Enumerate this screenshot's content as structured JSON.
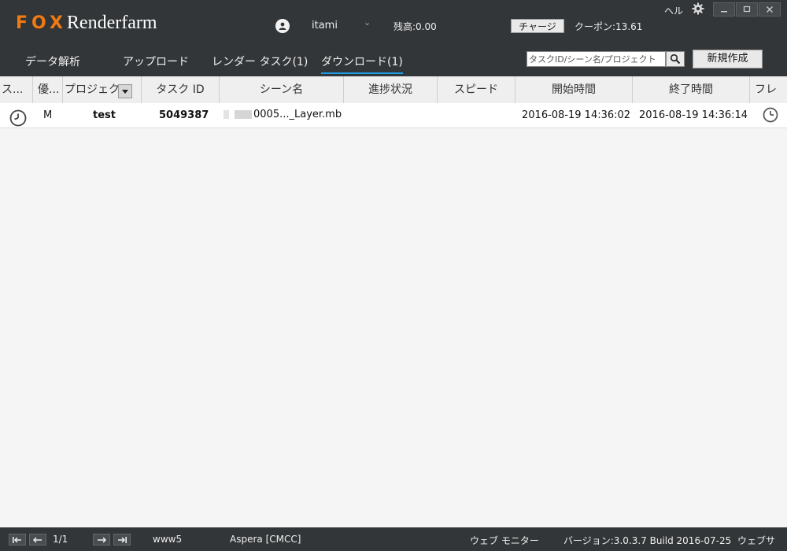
{
  "header": {
    "logo_fox": "FOX",
    "logo_text": "Renderfarm",
    "username": "itami",
    "balance": "残高:0.00",
    "charge_label": "チャージ",
    "coupon": "クーポン:13.61",
    "help_label": "ヘル"
  },
  "nav": {
    "tabs": [
      {
        "label": "データ解析"
      },
      {
        "label": "アップロード"
      },
      {
        "label": "レンダー タスク(1)"
      },
      {
        "label": "ダウンロード(1)"
      }
    ],
    "active_tab": 3,
    "search_placeholder": "タスクID/シーン名/プロジェクト",
    "new_label": "新規作成"
  },
  "table": {
    "columns": [
      "ス...",
      "優...",
      "プロジェク",
      "タスク ID",
      "シーン名",
      "進捗状況",
      "スピード",
      "開始時間",
      "終了時間",
      "フレ"
    ],
    "rows": [
      {
        "status_icon": "clock-icon",
        "priority": "M",
        "project": "test",
        "task_id": "5049387",
        "scene": "0005..._Layer.mb",
        "progress": "",
        "speed": "",
        "start": "2016-08-19 14:36:02",
        "end": "2016-08-19 14:36:14",
        "frame_icon": "clock-icon"
      }
    ]
  },
  "footer": {
    "page": "1/1",
    "server": "www5",
    "transfer": "Aspera [CMCC]",
    "web_monitor": "ウェブ モニター",
    "version": "バージョン:3.0.3.7 Build 2016-07-25",
    "web_site": "ウェブサ"
  },
  "colors": {
    "header_bg": "#333638",
    "accent_orange": "#f07a12",
    "active_tab_underline": "#1e9de6"
  }
}
